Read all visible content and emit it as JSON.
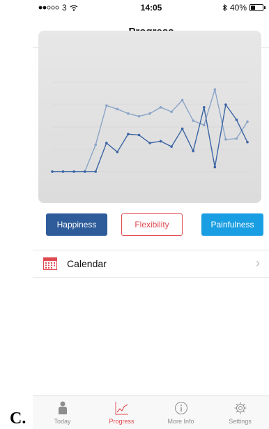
{
  "figure_label": "C.",
  "status_bar": {
    "carrier": "3",
    "time": "14:05",
    "battery_percent": "40%",
    "battery_level": 0.4
  },
  "nav": {
    "title": "Progress"
  },
  "chart_data": {
    "type": "line",
    "x": [
      1,
      2,
      3,
      4,
      5,
      6,
      7,
      8,
      9,
      10,
      11,
      12,
      13,
      14,
      15,
      16,
      17,
      18,
      19
    ],
    "ylim": [
      0,
      1
    ],
    "grid": true,
    "legend": "none",
    "series": [
      {
        "values": [
          0,
          0,
          0,
          0,
          0.3,
          0.74,
          0.7,
          0.65,
          0.62,
          0.65,
          0.72,
          0.67,
          0.8,
          0.57,
          0.52,
          0.92,
          0.36,
          0.37,
          0.56
        ],
        "color": "#8aa4c8"
      },
      {
        "values": [
          0,
          0,
          0,
          0,
          0,
          0.32,
          0.22,
          0.42,
          0.41,
          0.32,
          0.34,
          0.28,
          0.48,
          0.23,
          0.72,
          0.05,
          0.75,
          0.58,
          0.33
        ],
        "color": "#3a64a3"
      }
    ]
  },
  "buttons": {
    "happiness": "Happiness",
    "flexibility": "Flexibility",
    "painfulness": "Painfulness"
  },
  "calendar": {
    "label": "Calendar",
    "chevron": "›"
  },
  "tabs": [
    {
      "label": "Today",
      "icon": "person-icon"
    },
    {
      "label": "Progress",
      "icon": "progress-chart-icon",
      "active": true
    },
    {
      "label": "More Info",
      "icon": "info-icon"
    },
    {
      "label": "Settings",
      "icon": "gear-icon"
    }
  ],
  "colors": {
    "accent_red": "#e0484f",
    "happiness_blue": "#2e5c9a",
    "painfulness_blue": "#1a9ee3"
  }
}
